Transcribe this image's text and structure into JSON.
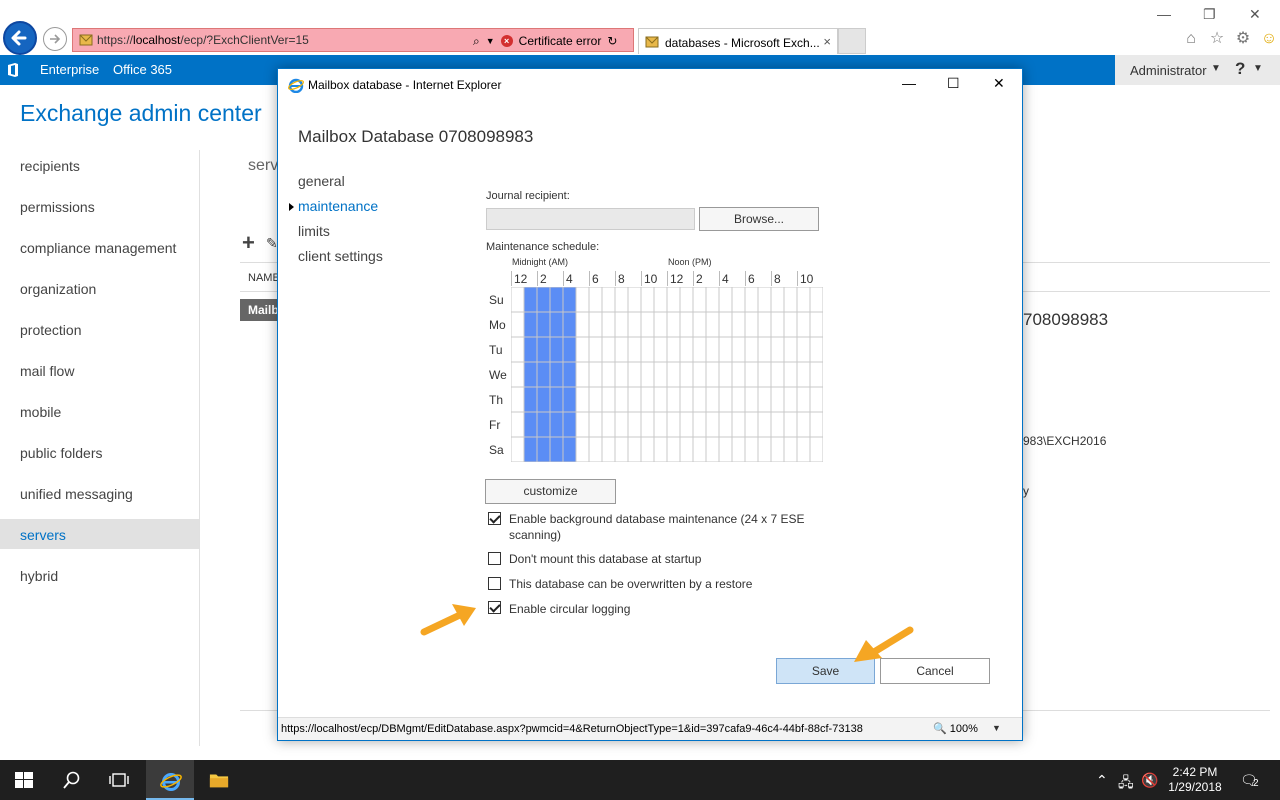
{
  "browser": {
    "url_prefix": "https://",
    "url_host": "localhost",
    "url_path": "/ecp/?ExchClientVer=15",
    "cert_error": "Certificate error",
    "tab_title": "databases - Microsoft Exch...",
    "tab_close": "×"
  },
  "eac": {
    "enterprise": "Enterprise",
    "office365": "Office 365",
    "user": "Administrator",
    "help": "?",
    "title": "Exchange admin center"
  },
  "nav": [
    {
      "label": "recipients"
    },
    {
      "label": "permissions"
    },
    {
      "label": "compliance management"
    },
    {
      "label": "organization"
    },
    {
      "label": "protection"
    },
    {
      "label": "mail flow"
    },
    {
      "label": "mobile"
    },
    {
      "label": "public folders"
    },
    {
      "label": "unified messaging"
    },
    {
      "label": "servers"
    },
    {
      "label": "hybrid"
    }
  ],
  "background": {
    "tab_label": "serv",
    "col_name": "NAME",
    "row_label": "Mailb",
    "detail_title": "708098983",
    "detail_path": "983\\EXCH2016",
    "detail_frag": "y"
  },
  "dialog": {
    "window_title": "Mailbox database - Internet Explorer",
    "heading": "Mailbox Database 0708098983",
    "nav": [
      "general",
      "maintenance",
      "limits",
      "client settings"
    ],
    "journal_label": "Journal recipient:",
    "browse": "Browse...",
    "schedule_label": "Maintenance schedule:",
    "midnight": "Midnight (AM)",
    "noon": "Noon (PM)",
    "hours": [
      "12",
      "2",
      "4",
      "6",
      "8",
      "10",
      "12",
      "2",
      "4",
      "6",
      "8",
      "10"
    ],
    "days": [
      "Su",
      "Mo",
      "Tu",
      "We",
      "Th",
      "Fr",
      "Sa"
    ],
    "customize": "customize",
    "checkboxes": [
      {
        "label": "Enable background database maintenance (24 x 7 ESE scanning)",
        "checked": true
      },
      {
        "label": "Don't mount this database at startup",
        "checked": false
      },
      {
        "label": "This database can be overwritten by a restore",
        "checked": false
      },
      {
        "label": "Enable circular logging",
        "checked": true
      }
    ],
    "save": "Save",
    "cancel": "Cancel",
    "status_url": "https://localhost/ecp/DBMgmt/EditDatabase.aspx?pwmcid=4&ReturnObjectType=1&id=397cafa9-46c4-44bf-88cf-73138",
    "zoom": "100%"
  },
  "taskbar": {
    "time": "2:42 PM",
    "date": "1/29/2018",
    "notifications": "2"
  },
  "colors": {
    "accent": "#0072c6",
    "schedule_fill": "#5b8df5",
    "arrow": "#f5a623"
  }
}
